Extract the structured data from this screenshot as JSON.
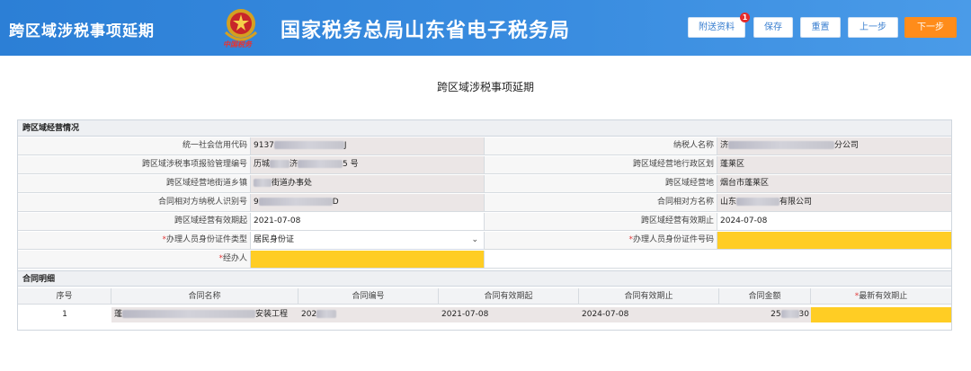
{
  "header": {
    "app_title": "跨区域涉税事项延期",
    "emblem_text": "中国税务",
    "bureau_title": "国家税务总局山东省电子税务局",
    "buttons": {
      "attach": "附送资料",
      "attach_badge": "1",
      "save": "保存",
      "reset": "重置",
      "prev": "上一步",
      "next": "下一步"
    }
  },
  "page_title": "跨区域涉税事项延期",
  "section_business": "跨区域经营情况",
  "fields": {
    "credit_code_label": "统一社会信用代码",
    "credit_code_value": "9137",
    "credit_code_suffix": "J",
    "taxpayer_name_label": "纳税人名称",
    "taxpayer_name_value": "济",
    "taxpayer_name_suffix": "分公司",
    "report_no_label": "跨区域涉税事项报验管理编号",
    "report_no_value": "历城",
    "report_no_mid": "济",
    "report_no_suffix": "5 号",
    "district_label": "跨区域经营地行政区划",
    "district_value": "蓬莱区",
    "street_label": "跨区域经营地街道乡镇",
    "street_value": "街道办事处",
    "biz_place_label": "跨区域经营地",
    "biz_place_value": "烟台市蓬莱区",
    "counterparty_id_label": "合同相对方纳税人识别号",
    "counterparty_id_value": "9",
    "counterparty_id_suffix": "D",
    "counterparty_name_label": "合同相对方名称",
    "counterparty_name_value": "山东",
    "counterparty_name_suffix": "有限公司",
    "valid_from_label": "跨区域经营有效期起",
    "valid_from_value": "2021-07-08",
    "valid_to_label": "跨区域经营有效期止",
    "valid_to_value": "2024-07-08",
    "id_type_label": "办理人员身份证件类型",
    "id_type_value": "居民身份证",
    "id_no_label": "办理人员身份证件号码",
    "handler_label": "经办人",
    "required_mark": "*"
  },
  "section_contract": "合同明细",
  "contract_table": {
    "headers": [
      "序号",
      "合同名称",
      "合同编号",
      "合同有效期起",
      "合同有效期止",
      "合同金额",
      "最新有效期止"
    ],
    "rows": [
      {
        "index": "1",
        "name_prefix": "蓬",
        "name_suffix": "安装工程",
        "number": "202",
        "start": "2021-07-08",
        "end": "2024-07-08",
        "amount_prefix": "25",
        "amount_suffix": "30"
      }
    ]
  },
  "colors": {
    "header_blue": "#2c7fd6",
    "next_orange": "#ff8c1a",
    "required_yellow": "#ffcd24",
    "badge_red": "#e52b2b"
  }
}
